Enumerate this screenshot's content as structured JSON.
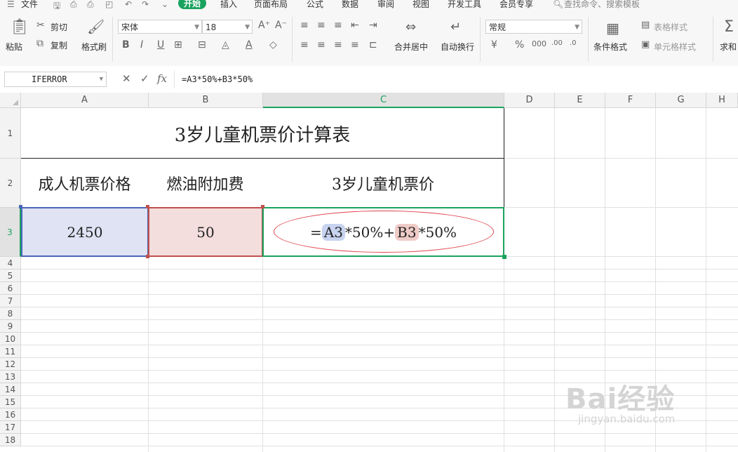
{
  "menu": {
    "file": "文件",
    "tabs": [
      "开始",
      "插入",
      "页面布局",
      "公式",
      "数据",
      "审阅",
      "视图",
      "开发工具",
      "会员专享"
    ],
    "active_tab": "开始",
    "search": "查找命令、搜索模板"
  },
  "ribbon": {
    "paste": "粘贴",
    "cut": "剪切",
    "copy": "复制",
    "format_painter": "格式刷",
    "font_name": "宋体",
    "font_size": "18",
    "merge_center": "合并居中",
    "wrap_text": "自动换行",
    "number_format": "常规",
    "cond_format": "条件格式",
    "table_style": "表格样式",
    "cell_style": "单元格样式",
    "sum": "求和"
  },
  "formula_bar": {
    "name_box": "IFERROR",
    "fx": "fx",
    "formula": "=A3*50%+B3*50%"
  },
  "columns": [
    "A",
    "B",
    "C",
    "D",
    "E",
    "F",
    "G",
    "H"
  ],
  "rows": [
    "1",
    "2",
    "3",
    "4",
    "5",
    "6",
    "7",
    "8",
    "9",
    "10",
    "11",
    "12",
    "13",
    "14",
    "15",
    "16",
    "17",
    "18"
  ],
  "sheet": {
    "title": "3岁儿童机票价计算表",
    "headers": [
      "成人机票价格",
      "燃油附加费",
      "3岁儿童机票价"
    ],
    "values": [
      "2450",
      "50"
    ],
    "formula_parts": {
      "eq": "=",
      "ref_a": "A3",
      "mid": "*50%+",
      "ref_b": "B3",
      "tail": "*50%"
    }
  },
  "colors": {
    "accent": "#1aa35f",
    "cell_a3_fill": "#dfe3f4",
    "cell_b3_fill": "#f4dedd",
    "ellipse": "#e0434b"
  },
  "watermark": {
    "logo_text": "Bai经验",
    "url": "jingyan.baidu.com"
  }
}
